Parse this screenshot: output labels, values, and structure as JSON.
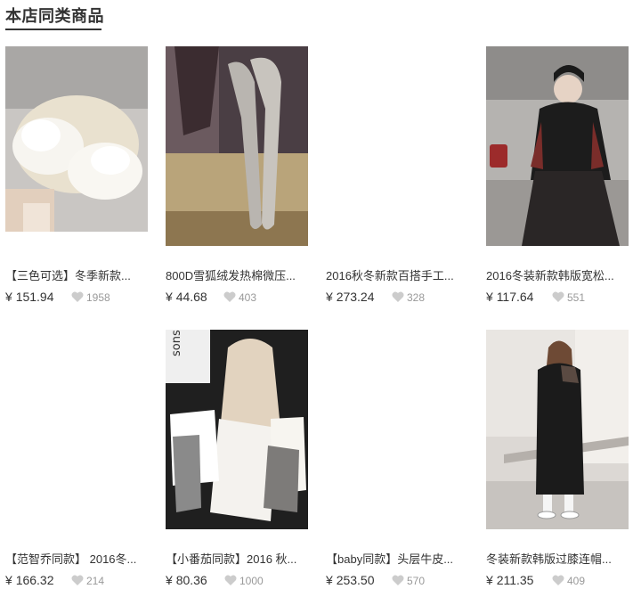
{
  "section": {
    "title": "本店同类商品"
  },
  "currency_symbol": "¥",
  "products": [
    {
      "title": "【三色可选】冬季新款...",
      "price": "151.94",
      "likes": "1958"
    },
    {
      "title": "800D雪狐绒发热棉微压...",
      "price": "44.68",
      "likes": "403"
    },
    {
      "title": "2016秋冬新款百搭手工...",
      "price": "273.24",
      "likes": "328"
    },
    {
      "title": "2016冬装新款韩版宽松...",
      "price": "117.64",
      "likes": "551"
    },
    {
      "title": "【范智乔同款】 2016冬...",
      "price": "166.32",
      "likes": "214"
    },
    {
      "title": "【小番茄同款】2016 秋...",
      "price": "80.36",
      "likes": "1000"
    },
    {
      "title": "【baby同款】头层牛皮...",
      "price": "253.50",
      "likes": "570"
    },
    {
      "title": "冬装新款韩版过膝连帽...",
      "price": "211.35",
      "likes": "409"
    }
  ],
  "image_texts": {
    "book_spine": "sons father"
  },
  "colors": {
    "text": "#333333",
    "muted": "#999999",
    "heart": "#cccccc"
  }
}
